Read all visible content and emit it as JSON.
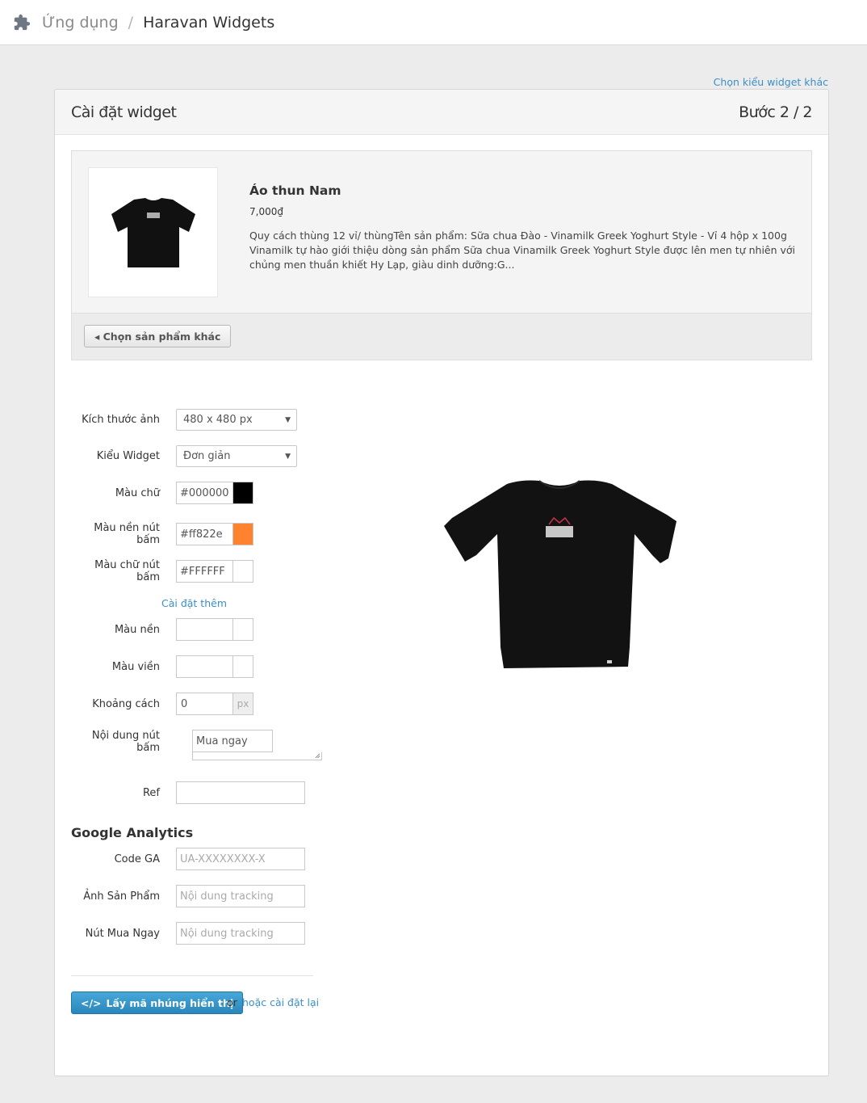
{
  "breadcrumb": {
    "root": "Ứng dụng",
    "separator": "/",
    "current": "Haravan Widgets"
  },
  "header_link": "Chọn kiểu widget khác",
  "panel": {
    "title": "Cài đặt widget",
    "step": "Bước 2 / 2"
  },
  "product": {
    "name": "Áo thun Nam",
    "price": "7,000₫",
    "description": "Quy cách thùng 12 vỉ/ thùngTên sản phẩm: Sữa chua Đào - Vinamilk Greek Yoghurt Style - Vỉ 4 hộp x 100g Vinamilk tự hào giới thiệu dòng sản phẩm Sữa chua Vinamilk Greek Yoghurt Style được lên men tự nhiên với chủng men thuần khiết Hy Lạp, giàu dinh dưỡng:G...",
    "choose_other": "◂ Chọn sản phẩm khác"
  },
  "form": {
    "image_size": {
      "label": "Kích thước ảnh",
      "value": "480 x 480 px"
    },
    "widget_type": {
      "label": "Kiểu Widget",
      "value": "Đơn giản"
    },
    "text_color": {
      "label": "Màu chữ",
      "value": "#000000",
      "swatch": "#000000"
    },
    "button_bg": {
      "label": "Màu nền nút bấm",
      "value": "#ff822e",
      "swatch": "#ff822e"
    },
    "button_text_color": {
      "label": "Màu chữ nút bấm",
      "value": "#FFFFFF",
      "swatch": "#ffffff"
    },
    "more_settings": "Cài đặt thêm",
    "background": {
      "label": "Màu nền",
      "value": ""
    },
    "border": {
      "label": "Màu viền",
      "value": ""
    },
    "spacing": {
      "label": "Khoảng cách",
      "value": "0",
      "unit": "px"
    },
    "button_content": {
      "label": "Nội dung nút bấm",
      "value": "Mua ngay"
    },
    "ref": {
      "label": "Ref",
      "value": ""
    }
  },
  "analytics": {
    "title": "Google Analytics",
    "code_ga": {
      "label": "Code GA",
      "placeholder": "UA-XXXXXXXX-X"
    },
    "product_image": {
      "label": "Ảnh Sản Phẩm",
      "placeholder": "Nội dung tracking"
    },
    "buy_now": {
      "label": "Nút Mua Ngay",
      "placeholder": "Nội dung tracking"
    }
  },
  "actions": {
    "embed_icon": "</>",
    "embed_label": "Lấy mã nhúng hiển thị",
    "or": "or",
    "reset": "hoặc cài đặt lại"
  }
}
